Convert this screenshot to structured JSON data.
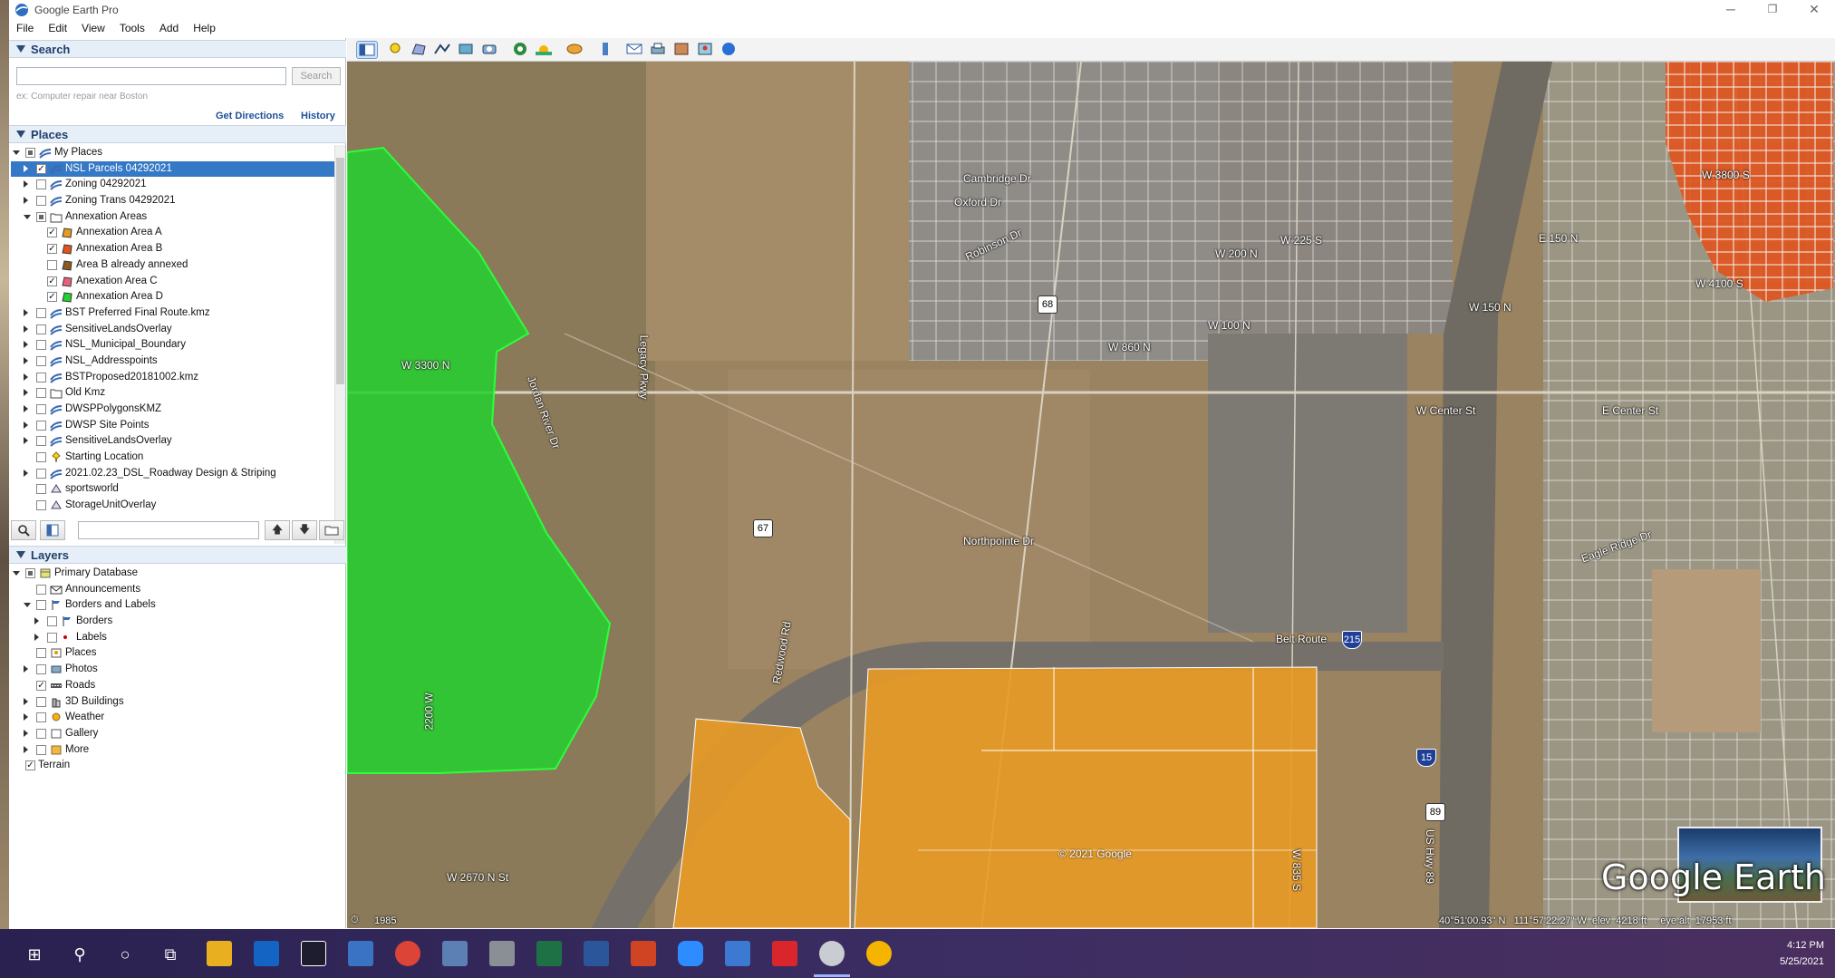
{
  "window": {
    "title": "Google Earth Pro",
    "minimize": "─",
    "maximize": "❐",
    "close": "✕"
  },
  "menu": [
    "File",
    "Edit",
    "View",
    "Tools",
    "Add",
    "Help"
  ],
  "search": {
    "header": "Search",
    "placeholder": "",
    "button": "Search",
    "hint": "ex: Computer repair near Boston",
    "get_directions": "Get Directions",
    "history": "History"
  },
  "places": {
    "header": "Places",
    "items": [
      {
        "label": "My Places",
        "level": 0,
        "expander": "open",
        "check": "part",
        "icon": "folder-blue-icon"
      },
      {
        "label": "NSL Parcels 04292021",
        "level": 1,
        "expander": "closed",
        "check": "checked",
        "icon": "kml-layer-icon",
        "selected": true
      },
      {
        "label": "Zoning 04292021",
        "level": 1,
        "expander": "closed",
        "check": "none",
        "icon": "kml-layer-icon"
      },
      {
        "label": "Zoning Trans 04292021",
        "level": 1,
        "expander": "closed",
        "check": "none",
        "icon": "kml-layer-icon"
      },
      {
        "label": "Annexation Areas",
        "level": 1,
        "expander": "open",
        "check": "part",
        "icon": "folder-icon"
      },
      {
        "label": "Annexation Area A",
        "level": 2,
        "expander": "",
        "check": "checked",
        "icon": "polygon-icon",
        "color": "#e89a25"
      },
      {
        "label": "Annexation Area B",
        "level": 2,
        "expander": "",
        "check": "checked",
        "icon": "polygon-icon",
        "color": "#e0531c"
      },
      {
        "label": "Area B already annexed",
        "level": 2,
        "expander": "",
        "check": "none",
        "icon": "polygon-icon",
        "color": "#8a5a1e"
      },
      {
        "label": "Anexation Area C",
        "level": 2,
        "expander": "",
        "check": "checked",
        "icon": "polygon-icon",
        "color": "#e8607e"
      },
      {
        "label": "Annexation Area D",
        "level": 2,
        "expander": "",
        "check": "checked",
        "icon": "polygon-icon",
        "color": "#22d12f"
      },
      {
        "label": "BST Preferred Final Route.kmz",
        "level": 1,
        "expander": "closed",
        "check": "none",
        "icon": "kml-layer-icon"
      },
      {
        "label": "SensitiveLandsOverlay",
        "level": 1,
        "expander": "closed",
        "check": "none",
        "icon": "kml-layer-icon"
      },
      {
        "label": "NSL_Municipal_Boundary",
        "level": 1,
        "expander": "closed",
        "check": "none",
        "icon": "kml-layer-icon"
      },
      {
        "label": "NSL_Addresspoints",
        "level": 1,
        "expander": "closed",
        "check": "none",
        "icon": "kml-layer-icon"
      },
      {
        "label": "BSTProposed20181002.kmz",
        "level": 1,
        "expander": "closed",
        "check": "none",
        "icon": "kml-layer-icon"
      },
      {
        "label": "Old Kmz",
        "level": 1,
        "expander": "closed",
        "check": "none",
        "icon": "folder-icon"
      },
      {
        "label": "DWSPPolygonsKMZ",
        "level": 1,
        "expander": "closed",
        "check": "none",
        "icon": "kml-layer-icon"
      },
      {
        "label": "DWSP Site Points",
        "level": 1,
        "expander": "closed",
        "check": "none",
        "icon": "kml-layer-icon"
      },
      {
        "label": "SensitiveLandsOverlay",
        "level": 1,
        "expander": "closed",
        "check": "none",
        "icon": "kml-layer-icon"
      },
      {
        "label": "Starting Location",
        "level": 1,
        "expander": "",
        "check": "none",
        "icon": "pin-icon"
      },
      {
        "label": "2021.02.23_DSL_Roadway Design & Striping",
        "level": 1,
        "expander": "closed",
        "check": "none",
        "icon": "kml-layer-icon"
      },
      {
        "label": "sportsworld",
        "level": 1,
        "expander": "",
        "check": "none",
        "icon": "overlay-icon"
      },
      {
        "label": "StorageUnitOverlay",
        "level": 1,
        "expander": "",
        "check": "none",
        "icon": "overlay-icon"
      }
    ]
  },
  "layers": {
    "header": "Layers",
    "items": [
      {
        "label": "Primary Database",
        "level": 0,
        "expander": "open",
        "check": "part",
        "icon": "database-icon"
      },
      {
        "label": "Announcements",
        "level": 1,
        "expander": "",
        "check": "none",
        "icon": "envelope-icon"
      },
      {
        "label": "Borders and Labels",
        "level": 1,
        "expander": "open",
        "check": "none",
        "icon": "flag-icon"
      },
      {
        "label": "Borders",
        "level": 2,
        "expander": "closed",
        "check": "none",
        "icon": "flag-icon"
      },
      {
        "label": "Labels",
        "level": 2,
        "expander": "closed",
        "check": "none",
        "icon": "dot-icon"
      },
      {
        "label": "Places",
        "level": 1,
        "expander": "",
        "check": "none",
        "icon": "places-icon"
      },
      {
        "label": "Photos",
        "level": 1,
        "expander": "closed",
        "check": "none",
        "icon": "photo-icon"
      },
      {
        "label": "Roads",
        "level": 1,
        "expander": "",
        "check": "checked",
        "icon": "road-icon"
      },
      {
        "label": "3D Buildings",
        "level": 1,
        "expander": "closed",
        "check": "none",
        "icon": "building-icon"
      },
      {
        "label": "Weather",
        "level": 1,
        "expander": "closed",
        "check": "none",
        "icon": "weather-icon"
      },
      {
        "label": "Gallery",
        "level": 1,
        "expander": "closed",
        "check": "none",
        "icon": "gallery-icon"
      },
      {
        "label": "More",
        "level": 1,
        "expander": "closed",
        "check": "none",
        "icon": "more-icon"
      },
      {
        "label": "Terrain",
        "level": 0,
        "expander": "",
        "check": "checked",
        "icon": ""
      }
    ]
  },
  "map": {
    "road_labels": [
      "W 3300 N",
      "Jordan River Dr",
      "Legacy Pkwy",
      "Northpointe Dr",
      "Redwood Rd",
      "Belt Route",
      "W Center St",
      "E Center St",
      "Cambridge Dr",
      "Oxford Dr",
      "Robinson Dr",
      "W 225 S",
      "W 200 N",
      "W 100 N",
      "W 150 N",
      "E 150 N",
      "W 3800 S",
      "W 4100 S",
      "Eagle Ridge Dr",
      "W 2670 N St",
      "2200 W",
      "US Hwy 89",
      "W 835 S",
      "W 860 N"
    ],
    "shields": [
      "68",
      "67",
      "215",
      "15",
      "89"
    ],
    "copyright": "© 2021 Google",
    "logo": "Google Earth",
    "imagery_year": "1985",
    "status": "40°51'00.93\" N   111°57'22.27\" W  elev  4218 ft     eye alt  17953 ft"
  },
  "taskbar": {
    "time": "4:12 PM",
    "date": "5/25/2021"
  },
  "colors": {
    "area_a": "#e89a25",
    "area_b": "#e0531c",
    "area_d": "#22d12f",
    "selection": "#3478c6"
  }
}
